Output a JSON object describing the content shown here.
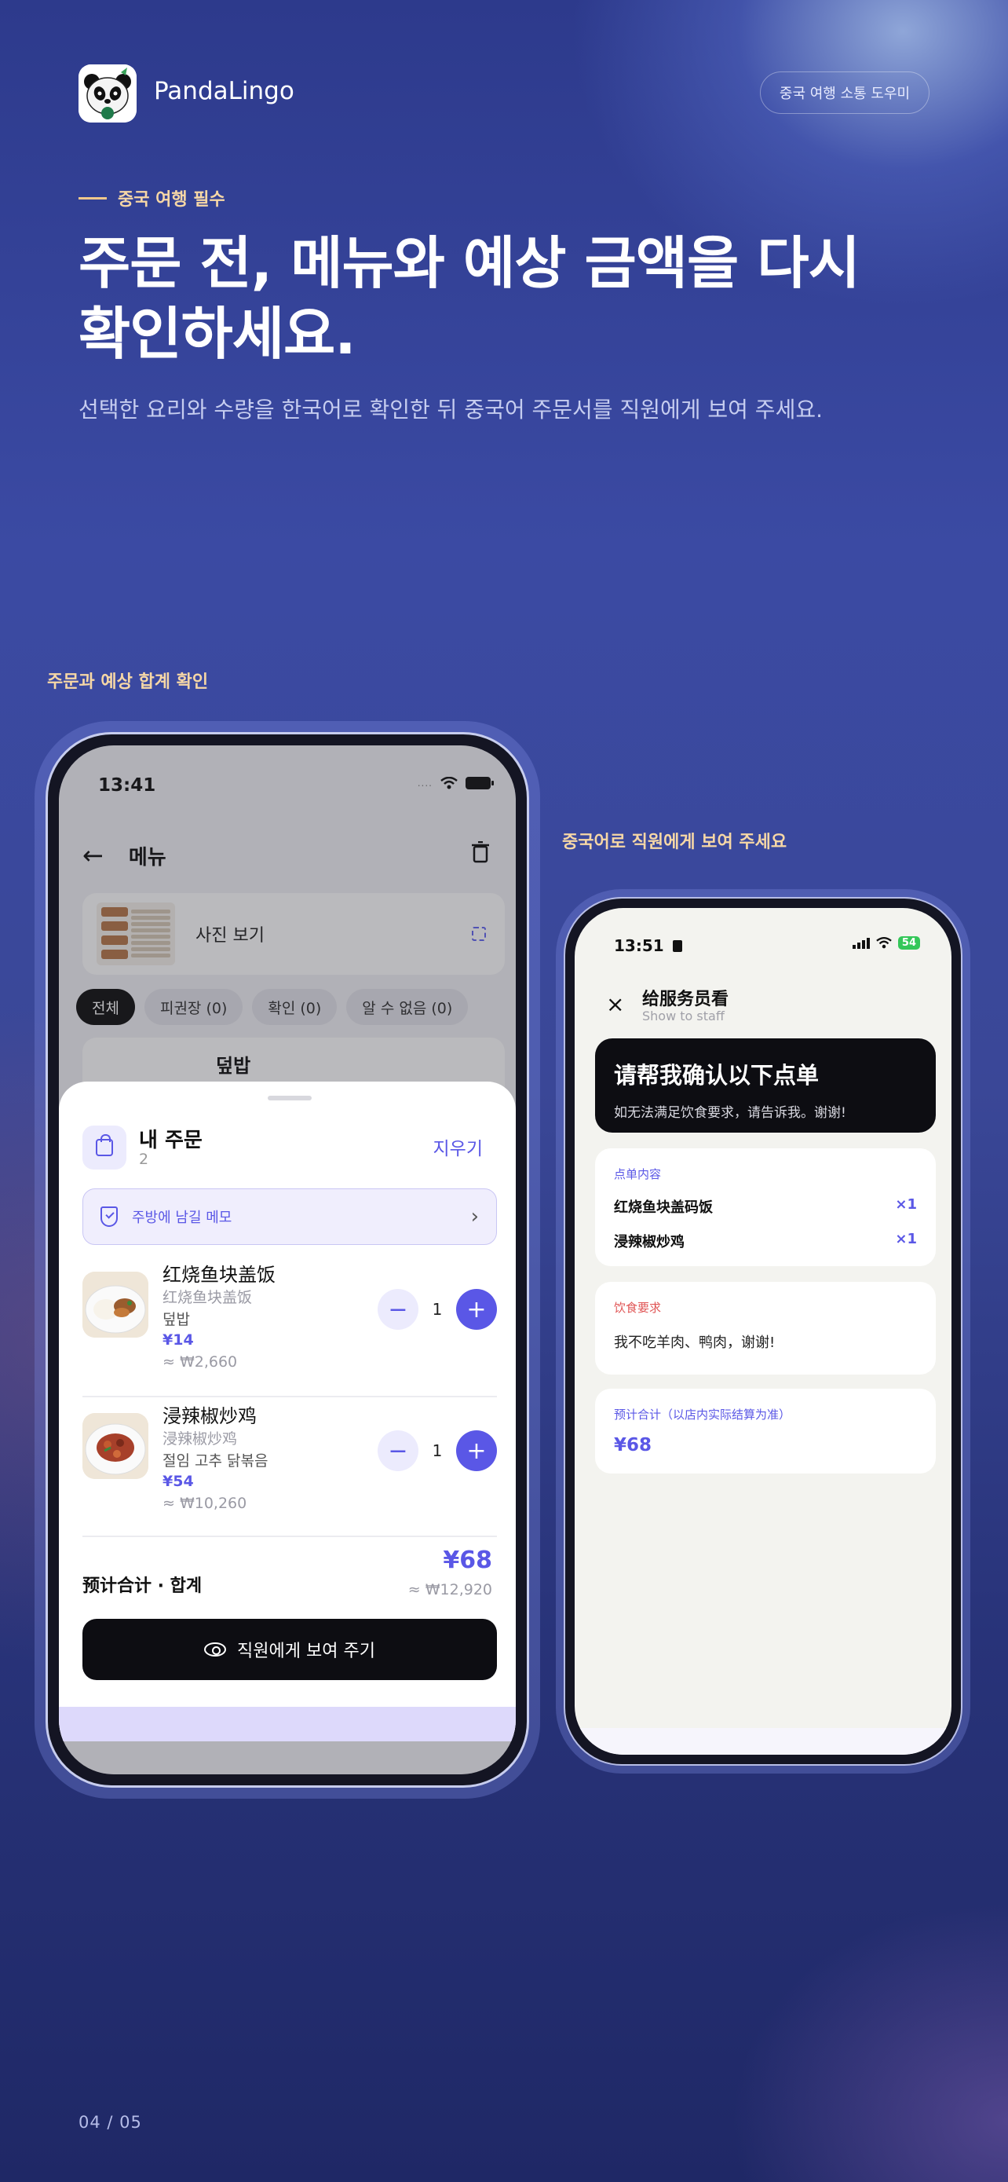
{
  "brand": {
    "app_name": "PandaLingo",
    "tag": "중국 여행 소통 도우미"
  },
  "hero": {
    "eyebrow": "중국 여행 필수",
    "headline": "주문 전, 메뉴와 예상 금액을 다시 확인하세요.",
    "subline": "선택한 요리와 수량을 한국어로 확인한 뒤 중국어 주문서를 직원에게 보여 주세요."
  },
  "captions": {
    "left": "주문과 예상 합계 확인",
    "right": "중국어로 직원에게 보여 주세요"
  },
  "left_phone": {
    "status_time": "13:41",
    "nav_title": "메뉴",
    "photo_view_label": "사진 보기",
    "chips": [
      "전체",
      "피권장 (0)",
      "확인 (0)",
      "알 수 없음 (0)"
    ],
    "dish_peek_name": "덮밥",
    "sheet": {
      "title": "내 주문",
      "count": "2",
      "clear_label": "지우기",
      "memo_label": "주방에 남길 메모",
      "items": [
        {
          "zh": "红烧鱼块盖饭",
          "zh_sub": "红烧鱼块盖饭",
          "ko": "덮밥",
          "price": "¥14",
          "krw": "≈ ₩2,660",
          "qty": "1"
        },
        {
          "zh": "浸辣椒炒鸡",
          "zh_sub": "浸辣椒炒鸡",
          "ko": "절임 고추 닭볶음",
          "price": "¥54",
          "krw": "≈ ₩10,260",
          "qty": "1"
        }
      ],
      "total_label": "预计合计 · 합계",
      "total_cny": "¥68",
      "total_krw": "≈ ₩12,920",
      "show_button": "직원에게 보여 주기"
    }
  },
  "right_phone": {
    "status_time": "13:51",
    "battery": "54",
    "title": "给服务员看",
    "subtitle": "Show to staff",
    "hero_title": "请帮我确认以下点单",
    "hero_sub": "如无法满足饮食要求，请告诉我。谢谢!",
    "order_label": "点单内容",
    "order_lines": [
      {
        "name": "红烧鱼块盖码饭",
        "qty": "×1"
      },
      {
        "name": "浸辣椒炒鸡",
        "qty": "×1"
      }
    ],
    "diet_label": "饮食要求",
    "diet_text": "我不吃羊肉、鸭肉，谢谢!",
    "total_label": "预计合计（以店内实际结算为准）",
    "total_value": "¥68"
  },
  "pager": "04 / 05"
}
